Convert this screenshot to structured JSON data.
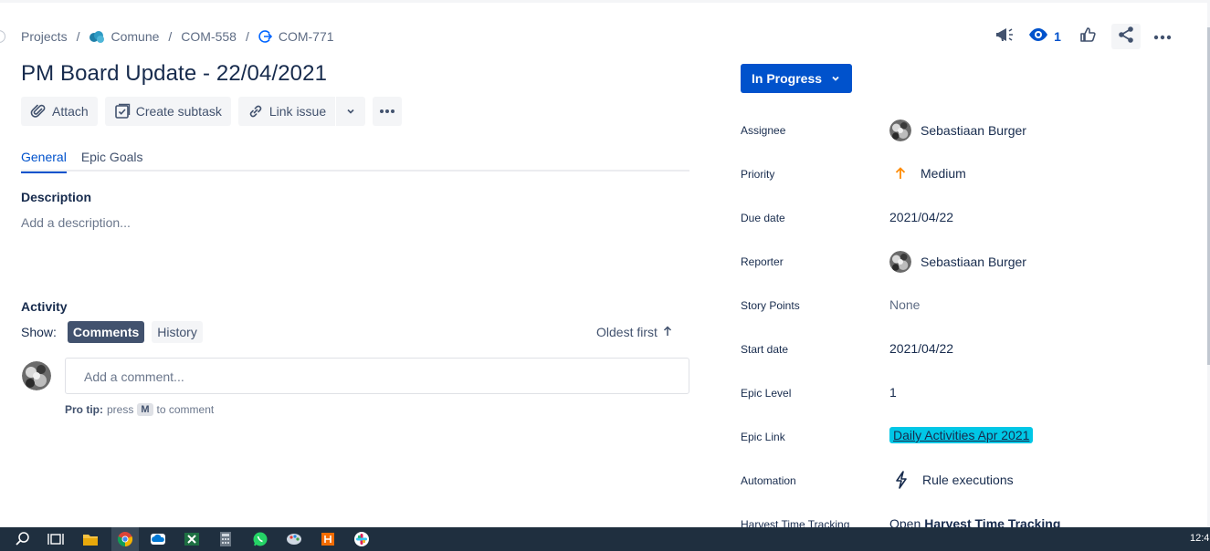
{
  "breadcrumb": {
    "projects": "Projects",
    "separator": "/",
    "project": "Comune",
    "epic": "COM-558",
    "issue": "COM-771"
  },
  "title": "PM Board Update - 22/04/2021",
  "toolbar": {
    "attach": "Attach",
    "create_subtask": "Create subtask",
    "link_issue": "Link issue"
  },
  "tabs": [
    "General",
    "Epic Goals"
  ],
  "description": {
    "label": "Description",
    "placeholder": "Add a description..."
  },
  "activity": {
    "label": "Activity",
    "show_label": "Show:",
    "filters": [
      "Comments",
      "History"
    ],
    "sort": "Oldest first",
    "comment_placeholder": "Add a comment...",
    "protip_bold": "Pro tip:",
    "protip_press": "press",
    "protip_key": "M",
    "protip_suffix": "to comment"
  },
  "header": {
    "watch_count": "1"
  },
  "status": {
    "label": "In Progress",
    "color": "#0052cc"
  },
  "fields": {
    "assignee": {
      "label": "Assignee",
      "value": "Sebastiaan Burger"
    },
    "priority": {
      "label": "Priority",
      "value": "Medium",
      "icon": "arrow-up-icon",
      "color": "#ff8b00"
    },
    "due_date": {
      "label": "Due date",
      "value": "2021/04/22"
    },
    "reporter": {
      "label": "Reporter",
      "value": "Sebastiaan Burger"
    },
    "story_points": {
      "label": "Story Points",
      "value": "None"
    },
    "start_date": {
      "label": "Start date",
      "value": "2021/04/22"
    },
    "epic_level": {
      "label": "Epic Level",
      "value": "1"
    },
    "epic_link": {
      "label": "Epic Link",
      "value": "Daily Activities Apr 2021",
      "color": "#00c7e6"
    },
    "automation": {
      "label": "Automation",
      "value": "Rule executions"
    },
    "harvest": {
      "label": "Harvest Time Tracking",
      "value_prefix": "Open",
      "value_bold": "Harvest Time Tracking"
    }
  },
  "taskbar": {
    "clock": "12:4"
  }
}
